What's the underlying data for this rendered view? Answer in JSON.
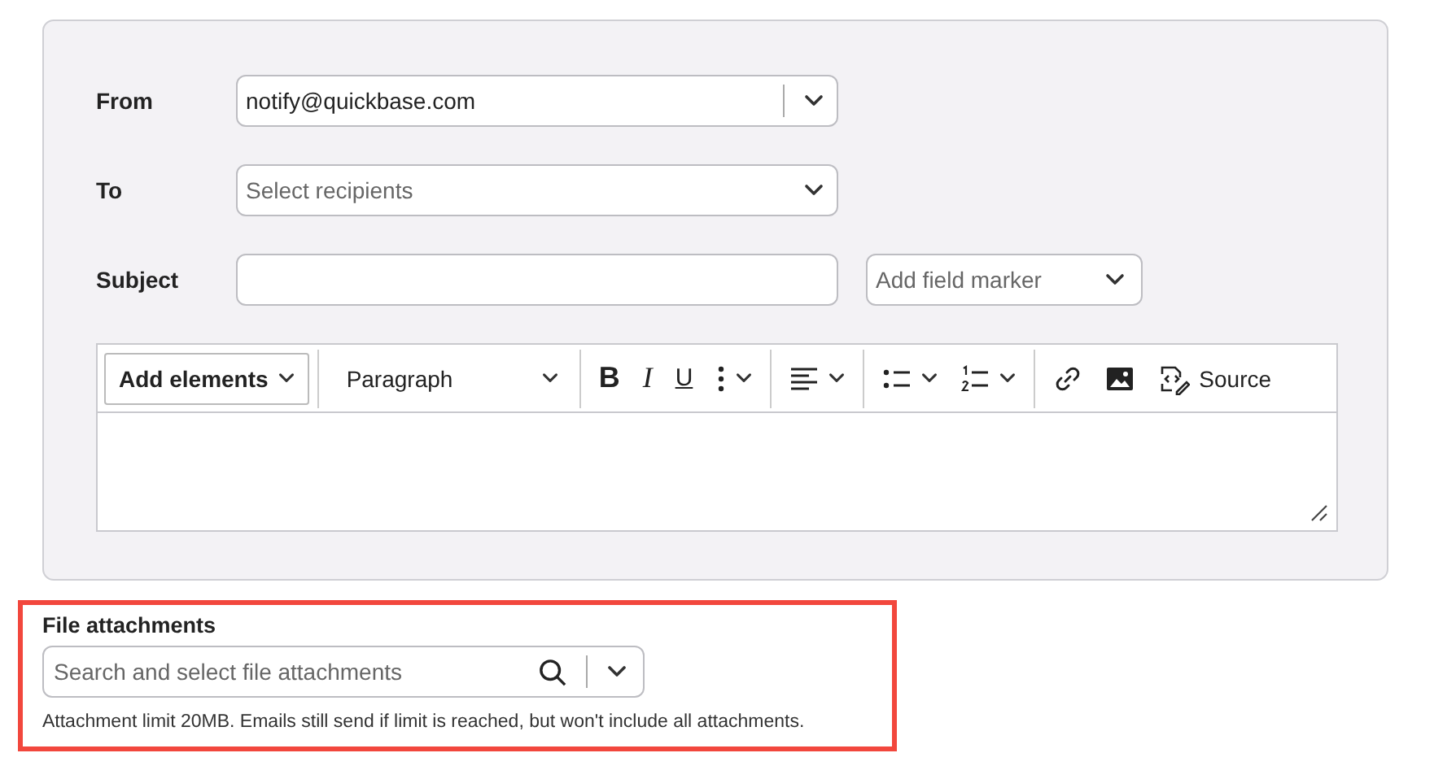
{
  "form": {
    "rows": [
      {
        "label": "From",
        "kind": "select",
        "value": "notify@quickbase.com",
        "divider": true
      },
      {
        "label": "To",
        "kind": "select",
        "placeholder": "Select recipients",
        "divider": false
      },
      {
        "label": "Subject",
        "kind": "text",
        "marker": {
          "placeholder": "Add field marker"
        }
      }
    ],
    "editor": {
      "toolbar": [
        {
          "kind": "dropdown-button",
          "label": "Add elements"
        },
        {
          "kind": "sep"
        },
        {
          "kind": "style-select",
          "label": "Paragraph"
        },
        {
          "kind": "sep"
        },
        {
          "kind": "bold",
          "text": "B"
        },
        {
          "kind": "italic",
          "text": "I"
        },
        {
          "kind": "underline",
          "text": "U"
        },
        {
          "kind": "more"
        },
        {
          "kind": "sep"
        },
        {
          "kind": "align"
        },
        {
          "kind": "sep"
        },
        {
          "kind": "bullets"
        },
        {
          "kind": "numbers"
        },
        {
          "kind": "sep"
        },
        {
          "kind": "link"
        },
        {
          "kind": "image"
        },
        {
          "kind": "source",
          "label": "Source"
        }
      ]
    }
  },
  "attachments": {
    "label": "File attachments",
    "placeholder": "Search and select file attachments",
    "help": "Attachment limit 20MB. Emails still send if limit is reached, but won't include all attachments.",
    "highlighted": true
  }
}
